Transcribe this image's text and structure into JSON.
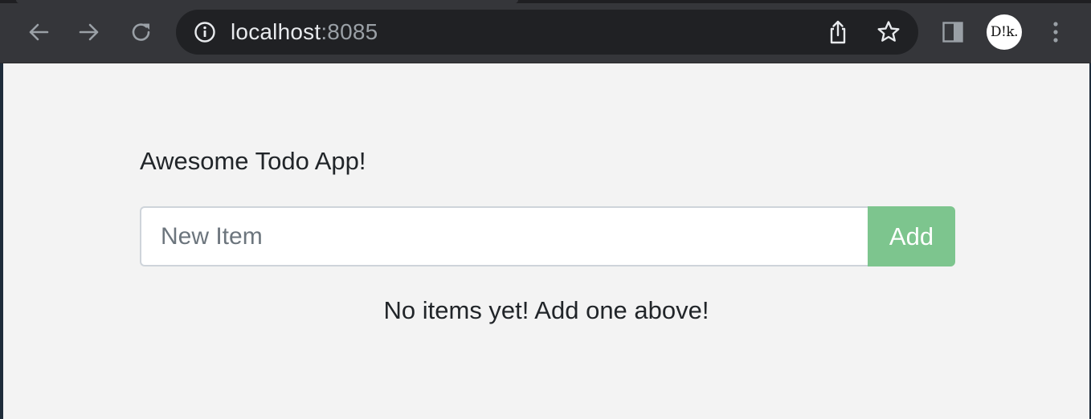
{
  "browser": {
    "url_host": "localhost",
    "url_port": ":8085",
    "profile_initials": "D!k.",
    "icons": {
      "back": "arrow-left-icon",
      "forward": "arrow-right-icon",
      "reload": "reload-icon",
      "site_info": "info-icon",
      "share": "share-icon",
      "bookmark": "star-icon",
      "side_panel": "side-panel-icon",
      "menu": "kebab-menu-icon"
    },
    "colors": {
      "toolbar": "#35363a",
      "omnibox": "#202124",
      "url_text": "#e8eaed",
      "url_port": "#9aa0a6",
      "icon": "#9aa0a6"
    }
  },
  "app": {
    "title": "Awesome Todo App!",
    "new_item_placeholder": "New Item",
    "new_item_value": "",
    "add_label": "Add",
    "empty_message": "No items yet! Add one above!",
    "colors": {
      "page_bg": "#f3f3f3",
      "add_button": "#7dc58e",
      "text": "#212529"
    }
  }
}
